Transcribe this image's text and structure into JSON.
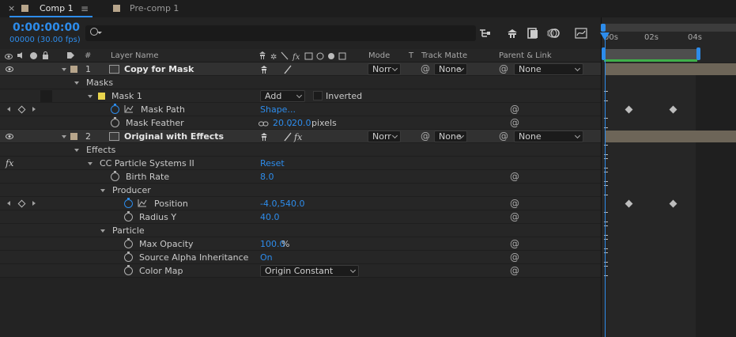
{
  "tabs": [
    {
      "label": "Comp 1",
      "close": "×",
      "menu": "≡",
      "active": true
    },
    {
      "label": "Pre-comp 1",
      "active": false
    }
  ],
  "header": {
    "timecode": "0:00:00:00",
    "frame_info": "00000 (30.00 fps)",
    "search_placeholder": ""
  },
  "columns": {
    "num": "#",
    "layer_name": "Layer Name",
    "mode": "Mode",
    "t": "T",
    "track_matte": "Track Matte",
    "parent_link": "Parent & Link"
  },
  "timeline": {
    "ruler": [
      "00s",
      "02s",
      "04s"
    ]
  },
  "rows": {
    "layer1": {
      "num": "1",
      "name": "Copy for Mask",
      "mode": "Norr",
      "matte": "None",
      "parent": "None"
    },
    "masks": {
      "label": "Masks"
    },
    "mask1": {
      "label": "Mask 1",
      "mode": "Add",
      "inverted": "Inverted"
    },
    "mask_path": {
      "label": "Mask Path",
      "value": "Shape..."
    },
    "mask_feather": {
      "label": "Mask Feather",
      "value_a": "20.0",
      "value_b": "20.0",
      "unit": "pixels",
      "sep": ","
    },
    "layer2": {
      "num": "2",
      "name": "Original with Effects",
      "mode": "Norr",
      "matte": "None",
      "parent": "None"
    },
    "effects": {
      "label": "Effects"
    },
    "cc_particle": {
      "label": "CC Particle Systems II",
      "value": "Reset"
    },
    "birth_rate": {
      "label": "Birth Rate",
      "value": "8.0"
    },
    "producer": {
      "label": "Producer"
    },
    "position": {
      "label": "Position",
      "value": "-4.0,540.0"
    },
    "radius_y": {
      "label": "Radius Y",
      "value": "40.0"
    },
    "particle": {
      "label": "Particle"
    },
    "max_opacity": {
      "label": "Max Opacity",
      "value": "100.0",
      "unit": "%"
    },
    "source_alpha": {
      "label": "Source Alpha Inheritance",
      "value": "On"
    },
    "color_map": {
      "label": "Color Map",
      "value": "Origin Constant"
    }
  },
  "fx_label": "fx",
  "colors": {
    "accent": "#2d8ceb",
    "label_tan": "#b7a58b",
    "mask_yellow": "#e8d44d",
    "work_area_green": "#3fb04a"
  }
}
